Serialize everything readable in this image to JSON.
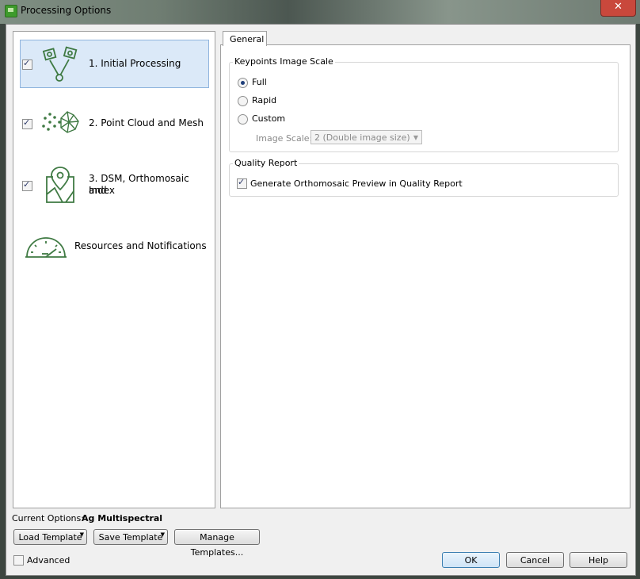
{
  "window": {
    "title": "Processing Options",
    "close": "✕"
  },
  "nav": {
    "items": [
      {
        "label": "1. Initial Processing",
        "checked": true
      },
      {
        "label": "2. Point Cloud and Mesh",
        "checked": true
      },
      {
        "label_line1": "3. DSM, Orthomosaic and",
        "label_line2": "Index",
        "checked": true
      },
      {
        "label": "Resources and Notifications"
      }
    ]
  },
  "tabs": {
    "general": "General"
  },
  "keypoints": {
    "title": "Keypoints Image Scale",
    "options": [
      "Full",
      "Rapid",
      "Custom"
    ],
    "selected": "Full",
    "image_scale_label": "Image Scale:",
    "image_scale_value": "2 (Double image size)"
  },
  "quality": {
    "title": "Quality Report",
    "preview_label": "Generate Orthomosaic Preview in Quality Report",
    "preview_checked": true
  },
  "footer": {
    "current_options_label": "Current Options:",
    "current_options_value": "Ag Multispectral",
    "load_template": "Load Template",
    "save_template": "Save Template",
    "manage_templates": "Manage Templates...",
    "advanced": "Advanced",
    "ok": "OK",
    "cancel": "Cancel",
    "help": "Help"
  },
  "colors": {
    "icon_green": "#3f7a43",
    "selection": "#dbe9f8"
  }
}
